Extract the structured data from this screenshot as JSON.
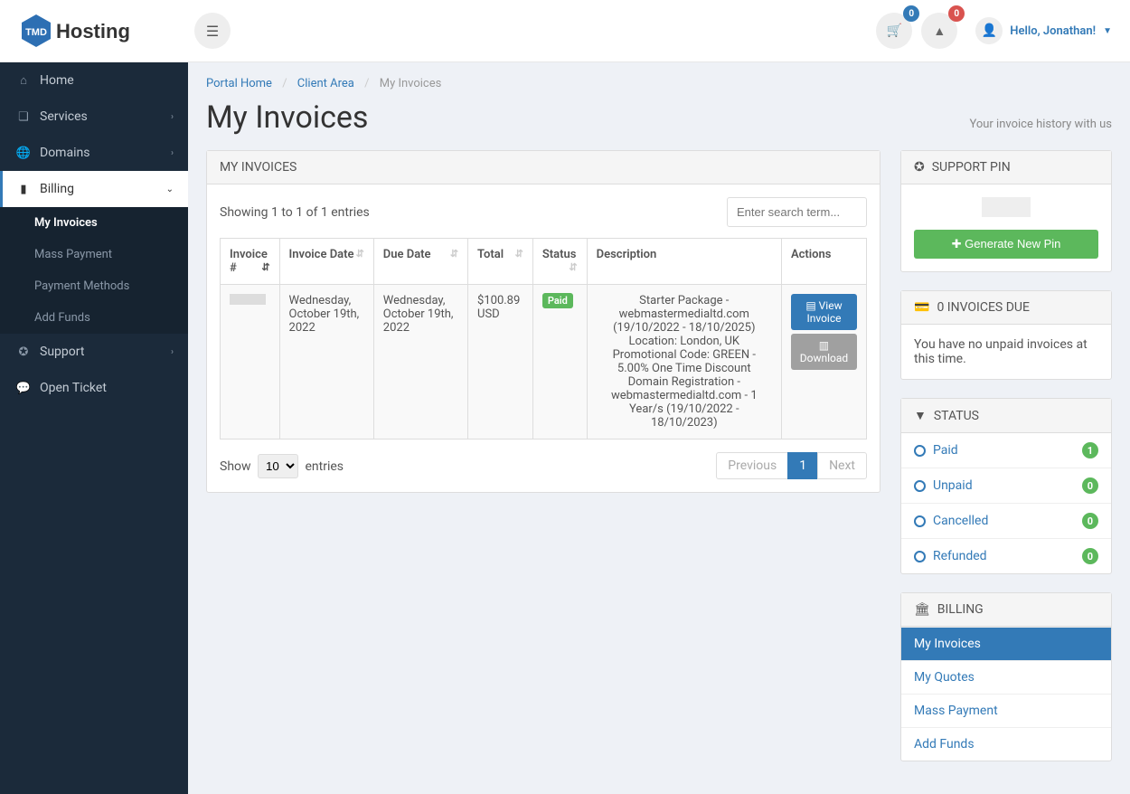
{
  "header": {
    "cart_count": "0",
    "alert_count": "0",
    "greeting": "Hello, Jonathan!"
  },
  "sidebar": {
    "items": [
      {
        "label": "Home"
      },
      {
        "label": "Services"
      },
      {
        "label": "Domains"
      },
      {
        "label": "Billing"
      },
      {
        "label": "Support"
      },
      {
        "label": "Open Ticket"
      }
    ],
    "billing_sub": [
      {
        "label": "My Invoices"
      },
      {
        "label": "Mass Payment"
      },
      {
        "label": "Payment Methods"
      },
      {
        "label": "Add Funds"
      }
    ]
  },
  "breadcrumb": {
    "portal": "Portal Home",
    "client": "Client Area",
    "current": "My Invoices"
  },
  "page": {
    "title": "My Invoices",
    "subtitle": "Your invoice history with us"
  },
  "invoices_panel": {
    "header": "MY INVOICES",
    "showing_text": "Showing 1 to 1 of 1 entries",
    "search_placeholder": "Enter search term...",
    "columns": {
      "num": "Invoice #",
      "date": "Invoice Date",
      "due": "Due Date",
      "total": "Total",
      "status": "Status",
      "desc": "Description",
      "actions": "Actions"
    },
    "row": {
      "date": "Wednesday, October 19th, 2022",
      "due": "Wednesday, October 19th, 2022",
      "total": "$100.89 USD",
      "status": "Paid",
      "desc_l1": "Starter Package - webmastermedialtd.com (19/10/2022 - 18/10/2025) Location: London, UK",
      "desc_l2": "Promotional Code: GREEN - 5.00% One Time Discount",
      "desc_l3": "Domain Registration - webmastermedialtd.com - 1 Year/s (19/10/2022 - 18/10/2023)",
      "view": "View Invoice",
      "download": "Download"
    },
    "footer": {
      "show": "Show",
      "entries": "entries",
      "per_page": "10",
      "prev": "Previous",
      "page": "1",
      "next": "Next"
    }
  },
  "support_pin": {
    "header": "SUPPORT PIN",
    "button": "Generate New Pin"
  },
  "due_panel": {
    "header": "0 INVOICES DUE",
    "text": "You have no unpaid invoices at this time."
  },
  "status_panel": {
    "header": "STATUS",
    "items": [
      {
        "label": "Paid",
        "count": "1"
      },
      {
        "label": "Unpaid",
        "count": "0"
      },
      {
        "label": "Cancelled",
        "count": "0"
      },
      {
        "label": "Refunded",
        "count": "0"
      }
    ]
  },
  "billing_panel": {
    "header": "BILLING",
    "items": [
      {
        "label": "My Invoices"
      },
      {
        "label": "My Quotes"
      },
      {
        "label": "Mass Payment"
      },
      {
        "label": "Add Funds"
      }
    ]
  }
}
